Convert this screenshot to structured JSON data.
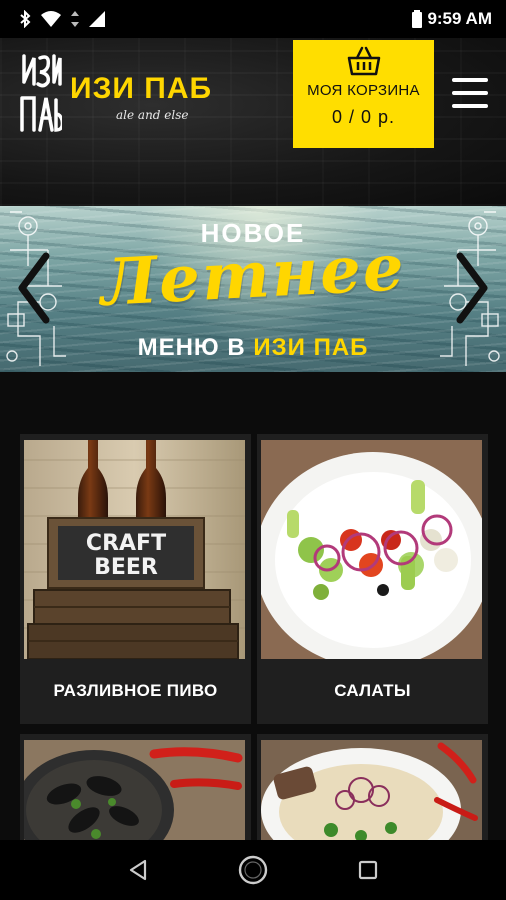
{
  "status_bar": {
    "time": "9:59 AM",
    "icons": [
      "bluetooth-icon",
      "wifi-icon",
      "data-arrows-icon",
      "signal-icon",
      "battery-icon"
    ]
  },
  "header": {
    "logo_mark_text": "ИЗИ ПАБ",
    "logo_title": "ИЗИ ПАБ",
    "logo_subtitle": "ale and else",
    "cart": {
      "icon": "basket-icon",
      "label": "МОЯ КОРЗИНА",
      "value": "0 / 0 р."
    },
    "menu_icon": "hamburger-menu-icon"
  },
  "banner": {
    "line1": "НОВОЕ",
    "script": "Летнее",
    "line3_prefix": "МЕНЮ В",
    "line3_brand_a": "ИЗИ",
    "line3_brand_b": "ПАБ",
    "prev_icon": "chevron-left-icon",
    "next_icon": "chevron-right-icon"
  },
  "categories": [
    {
      "title": "РАЗЛИВНОЕ ПИВО",
      "photo_sign": "CRAFT BEER"
    },
    {
      "title": "САЛАТЫ"
    },
    {
      "title": ""
    },
    {
      "title": ""
    }
  ],
  "nav": {
    "back_icon": "back-triangle-icon",
    "home_icon": "home-circle-icon",
    "recents_icon": "recents-square-icon"
  },
  "colors": {
    "accent_yellow": "#ffde00",
    "background": "#0c0c0c",
    "card": "#1f1f1f"
  }
}
